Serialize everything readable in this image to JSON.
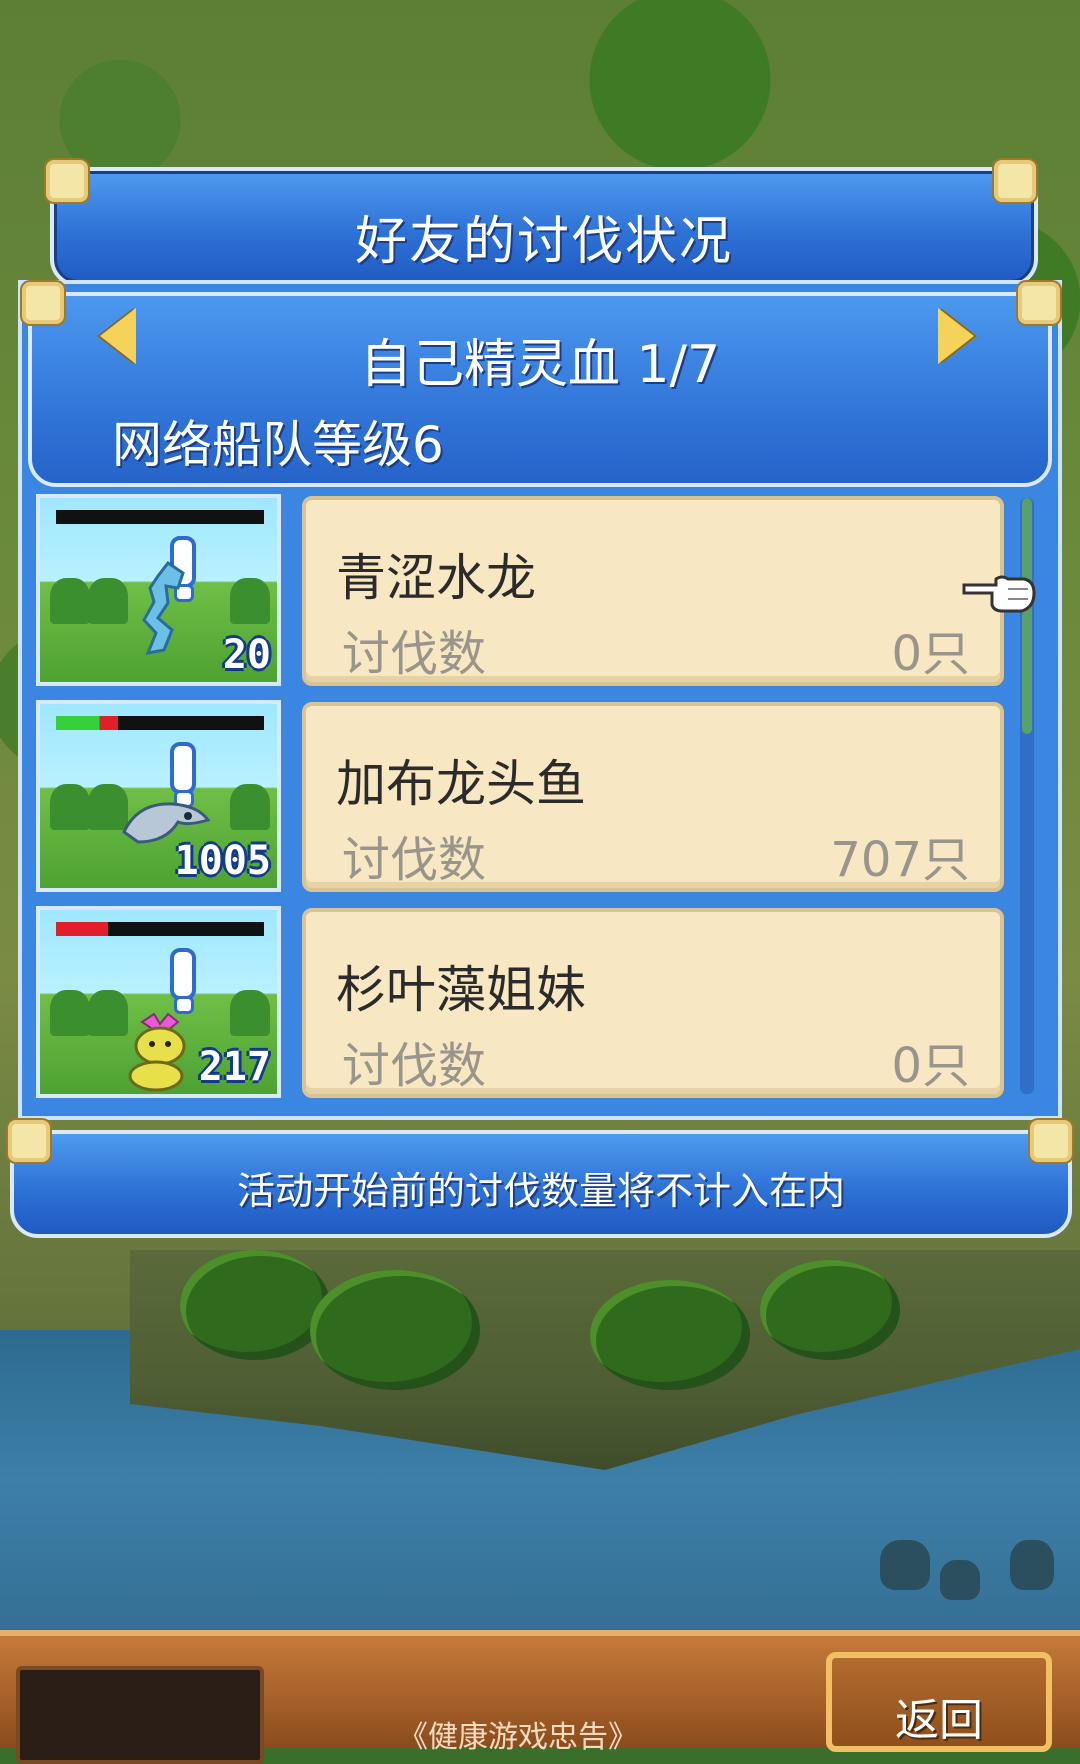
{
  "dialog": {
    "title": "好友的讨伐状况",
    "category": "自己精灵血 1/7",
    "fleet_level": "网络船队等级6",
    "notice": "活动开始前的讨伐数量将不计入在内"
  },
  "monsters": [
    {
      "name": "青涩水龙",
      "kill_label": "讨伐数",
      "kill_count": "0只",
      "level": "20",
      "hp_fraction": 0.0
    },
    {
      "name": "加布龙头鱼",
      "kill_label": "讨伐数",
      "kill_count": "707只",
      "level": "1005",
      "hp_fraction": 0.3
    },
    {
      "name": "杉叶藻姐妹",
      "kill_label": "讨伐数",
      "kill_count": "0只",
      "level": "217",
      "hp_fraction": 0.25
    }
  ],
  "colors": {
    "hp_green": "#35d03a",
    "hp_red": "#e11f2b",
    "panel_blue": "#2f72d6",
    "card_bg": "#f7e7c2"
  },
  "icons": {
    "prev": "arrow-left-icon",
    "next": "arrow-right-icon",
    "pointer": "pointing-hand-icon"
  },
  "bottom": {
    "back_label": "返回",
    "health_notice": "《健康游戏忠告》"
  }
}
